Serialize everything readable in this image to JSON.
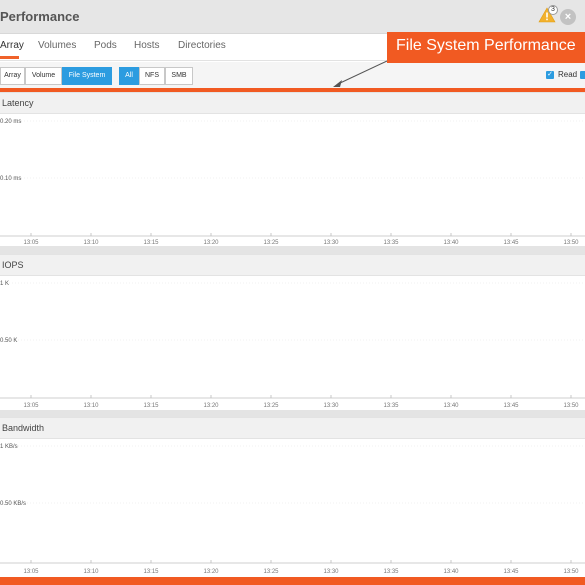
{
  "window": {
    "title": "Performance",
    "alert_count": "3",
    "close_glyph": "×"
  },
  "tabs": [
    {
      "label": "Array",
      "active": true
    },
    {
      "label": "Volumes",
      "active": false
    },
    {
      "label": "Pods",
      "active": false
    },
    {
      "label": "Hosts",
      "active": false
    },
    {
      "label": "Directories",
      "active": false
    }
  ],
  "filters": {
    "scope": [
      {
        "label": "Array",
        "selected": false
      },
      {
        "label": "Volume",
        "selected": false
      },
      {
        "label": "File System",
        "selected": true
      }
    ],
    "protocol": [
      {
        "label": "All",
        "selected": true
      },
      {
        "label": "NFS",
        "selected": false
      },
      {
        "label": "SMB",
        "selected": false
      }
    ],
    "read_label": "Read"
  },
  "callout": {
    "text": "File System Performance"
  },
  "colors": {
    "accent_orange": "#f15a22",
    "selected_blue": "#2c9ce0"
  },
  "chart_data": [
    {
      "type": "line",
      "title": "Latency",
      "y_ticks": [
        "0.20 ms",
        "0.10 ms"
      ],
      "x": [
        "13:05",
        "13:10",
        "13:15",
        "13:20",
        "13:25",
        "13:30",
        "13:35",
        "13:40",
        "13:45",
        "13:50"
      ],
      "series": [],
      "grid": true
    },
    {
      "type": "line",
      "title": "IOPS",
      "y_ticks": [
        "1 K",
        "0.50 K"
      ],
      "x": [
        "13:05",
        "13:10",
        "13:15",
        "13:20",
        "13:25",
        "13:30",
        "13:35",
        "13:40",
        "13:45",
        "13:50"
      ],
      "series": [],
      "grid": true
    },
    {
      "type": "line",
      "title": "Bandwidth",
      "y_ticks": [
        "1 KB/s",
        "0.50 KB/s"
      ],
      "x": [
        "13:05",
        "13:10",
        "13:15",
        "13:20",
        "13:25",
        "13:30",
        "13:35",
        "13:40",
        "13:45",
        "13:50"
      ],
      "series": [],
      "grid": true
    }
  ]
}
